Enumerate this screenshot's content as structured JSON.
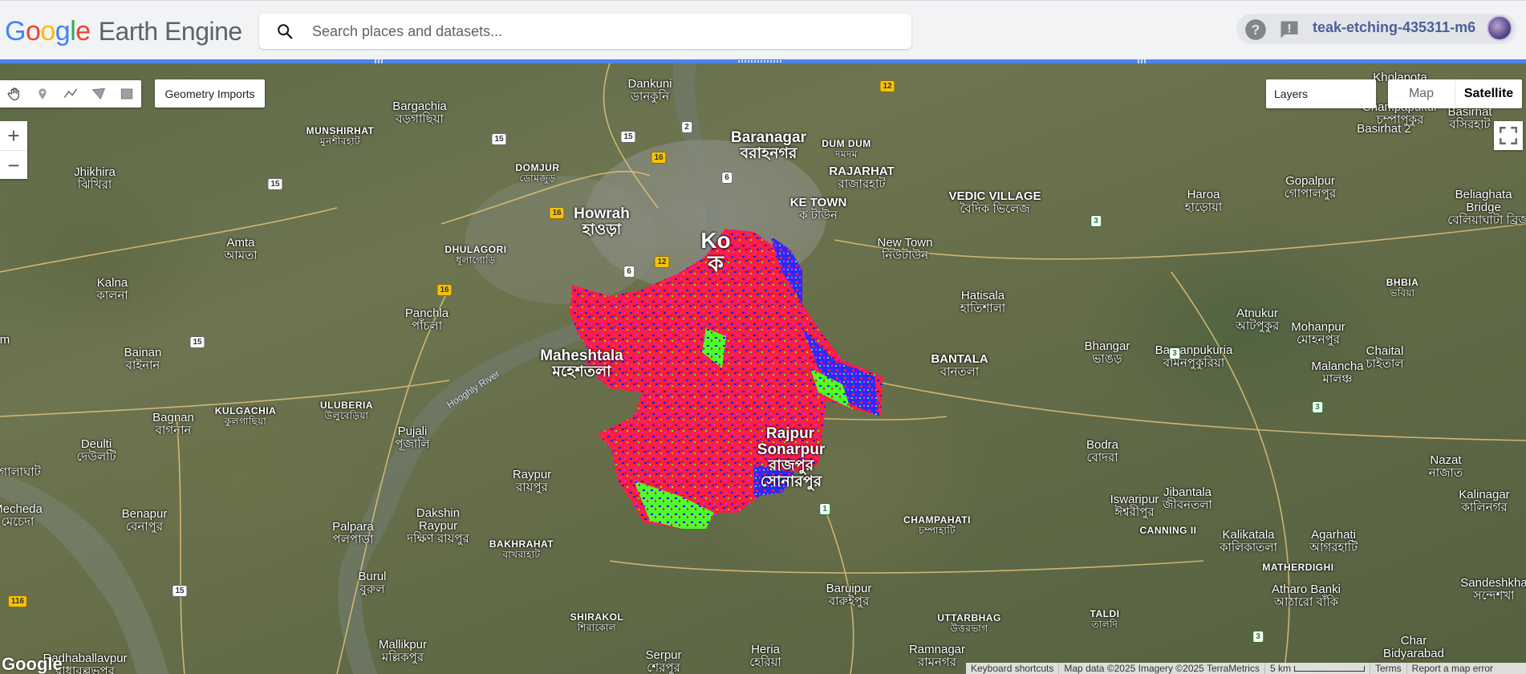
{
  "header": {
    "logo": {
      "g1": "G",
      "o1": "o",
      "o2": "o",
      "g2": "g",
      "l": "l",
      "e": "e",
      "product": "Earth Engine"
    },
    "search": {
      "placeholder": "Search places and datasets..."
    },
    "help_icon": "help-circle-icon",
    "feedback_icon": "feedback-icon",
    "project": "teak-etching-435311-m6"
  },
  "map_toolbar": {
    "tools": [
      "pan-hand-icon",
      "point-marker-icon",
      "line-icon",
      "polygon-icon",
      "rectangle-icon"
    ],
    "geometry_imports": "Geometry Imports"
  },
  "zoom": {
    "in": "+",
    "out": "−"
  },
  "layers": {
    "label": "Layers"
  },
  "map_type": {
    "map": "Map",
    "satellite": "Satellite",
    "selected": "Satellite"
  },
  "footer": {
    "watermark": "Google",
    "keyboard": "Keyboard shortcuts",
    "map_data": "Map data ©2025 Imagery ©2025 TerraMetrics",
    "scale": "5 km",
    "terms": "Terms",
    "report": "Report a map error"
  },
  "overlay_colors": {
    "red": "#ff1e3c",
    "blue": "#1a1aff",
    "green": "#4dff2a",
    "magenta": "#e01cff"
  },
  "places": {
    "baranagar": {
      "en": "Baranagar",
      "bn": "বরাহনগর"
    },
    "howrah": {
      "en": "Howrah",
      "bn": "হাওড়া"
    },
    "kolkata": {
      "en": "Ko",
      "bn": "ক"
    },
    "maheshtala": {
      "en": "Maheshtala",
      "bn": "মহেশতলা"
    },
    "rajpur": {
      "en": "Rajpur",
      "bn": ""
    },
    "sonarpur": {
      "en": "Sonarpur",
      "bn": "রাজপুর সোনারপুর"
    },
    "dankuni": {
      "en": "Dankuni",
      "bn": "ডানকুনি"
    },
    "bargachia": {
      "en": "Bargachia",
      "bn": "বড়গাছিয়া"
    },
    "munshirhat": {
      "en": "MUNSHIRHAT",
      "bn": "মুনশীরহাট"
    },
    "domjur": {
      "en": "DOMJUR",
      "bn": "ডোমজুড়"
    },
    "dumdum": {
      "en": "DUM DUM",
      "bn": "দমদম"
    },
    "rajarhat": {
      "en": "RAJARHAT",
      "bn": "রাজারহাট"
    },
    "laketown": {
      "en": "KE TOWN",
      "bn": "ক টাউন"
    },
    "vedic": {
      "en": "VEDIC VILLAGE",
      "bn": "বৈদিক ভিলেজ"
    },
    "haroa": {
      "en": "Haroa",
      "bn": "হাড়োয়া"
    },
    "gopalpur": {
      "en": "Gopalpur",
      "bn": "গোপালপুর"
    },
    "basirhat2": {
      "en": "Basirhat 2",
      "bn": ""
    },
    "basirhat": {
      "en": "Basirhat",
      "bn": "বসিরহাট"
    },
    "khola": {
      "en": "Kholapota",
      "bn": ""
    },
    "champapukur": {
      "en": "Champapukur",
      "bn": "চম্পাপুকুর"
    },
    "beliaghata": {
      "en": "Beliaghata Bridge",
      "bn": "বেলিয়াঘাটা ব্রিজ"
    },
    "jhikhira": {
      "en": "Jhikhira",
      "bn": "ঝিখিরা"
    },
    "amta": {
      "en": "Amta",
      "bn": "আমতা"
    },
    "dhulagori": {
      "en": "DHULAGORI",
      "bn": "ধূলাগোড়ি"
    },
    "newtown": {
      "en": "New Town",
      "bn": "নিউটাউন"
    },
    "hatisala": {
      "en": "Hatisala",
      "bn": "হাতিশালা"
    },
    "kalna": {
      "en": "Kalna",
      "bn": "কালনা"
    },
    "panchla": {
      "en": "Panchla",
      "bn": "পাঁচলা"
    },
    "atnukur": {
      "en": "Atnukur",
      "bn": "আটপুকুর"
    },
    "mohanpur": {
      "en": "Mohanpur",
      "bn": "মোহনপুর"
    },
    "bhbia": {
      "en": "BHBIA",
      "bn": "ভবিয়া"
    },
    "bainan": {
      "en": "Bainan",
      "bn": "বাইনান"
    },
    "bantala": {
      "en": "BANTALA",
      "bn": "বানতলা"
    },
    "bhangar": {
      "en": "Bhangar",
      "bn": "ভাঙড়"
    },
    "bamanpukuria": {
      "en": "Bamanpukuria",
      "bn": "বামনপুকুরিয়া"
    },
    "malancha": {
      "en": "Malancha",
      "bn": "মালঞ্চ"
    },
    "chaital": {
      "en": "Chaital",
      "bn": "চাইতাল"
    },
    "bagnan": {
      "en": "Bagnan",
      "bn": "বাগনান"
    },
    "kulgachia": {
      "en": "KULGACHIA",
      "bn": "কুলগাছিয়া"
    },
    "uluberia": {
      "en": "ULUBERIA",
      "bn": "উলুবেড়িয়া"
    },
    "pujali": {
      "en": "Pujali",
      "bn": "পূজালি"
    },
    "deulti": {
      "en": "Deulti",
      "bn": "দেউলটি"
    },
    "golaghat": {
      "en": "...",
      "bn": "গোলাঘাট"
    },
    "raypur": {
      "en": "Raypur",
      "bn": "রায়পুর"
    },
    "bodra": {
      "en": "Bodra",
      "bn": "বোদরা"
    },
    "iswaripur": {
      "en": "Iswaripur",
      "bn": "ঈশ্বরীপুর"
    },
    "jibantala": {
      "en": "Jibantala",
      "bn": "জীবনতলা"
    },
    "nazat": {
      "en": "Nazat",
      "bn": "নাজাত"
    },
    "kalinagar": {
      "en": "Kalinagar",
      "bn": "কালিনগর"
    },
    "mecheda": {
      "en": "Mecheda",
      "bn": "মেচেদা"
    },
    "benapur": {
      "en": "Benapur",
      "bn": "বেনাপুর"
    },
    "palpara": {
      "en": "Palpara",
      "bn": "পলপাড়া"
    },
    "dakshin": {
      "en": "Dakshin Raypur",
      "bn": "দক্ষিণ রায়পুর"
    },
    "bakhrahat": {
      "en": "BAKHRAHAT",
      "bn": "বাখরাহাট"
    },
    "champahati": {
      "en": "CHAMPAHATI",
      "bn": "চম্পাহাটি"
    },
    "canning": {
      "en": "CANNING II",
      "bn": ""
    },
    "kalikatala": {
      "en": "Kalikatala",
      "bn": "কালিকাতলা"
    },
    "agarhati": {
      "en": "Agarhati",
      "bn": "আগরহাটি"
    },
    "burul": {
      "en": "Burul",
      "bn": "বুরুল"
    },
    "shirakol": {
      "en": "SHIRAKOL",
      "bn": "শিরাকোল"
    },
    "baruipur": {
      "en": "Baruipur",
      "bn": "বারুইপুর"
    },
    "matherdighi": {
      "en": "MATHERDIGHI",
      "bn": ""
    },
    "atharo": {
      "en": "Atharo Banki",
      "bn": "আঠারো বাঁকি"
    },
    "sandeshkhali": {
      "en": "Sandeshkha",
      "bn": "সন্দেশখা"
    },
    "uttarbhag": {
      "en": "UTTARBHAG",
      "bn": "উত্তরভাগ"
    },
    "taldi": {
      "en": "TALDI",
      "bn": "তালদি"
    },
    "mallikpur": {
      "en": "Mallikpur",
      "bn": "মল্লিকপুর"
    },
    "serpur": {
      "en": "Serpur",
      "bn": "শেরপুর"
    },
    "heria": {
      "en": "Heria",
      "bn": "হেরিয়া"
    },
    "ramnagar": {
      "en": "Ramnagar",
      "bn": "রামনগর"
    },
    "radhaballav": {
      "en": "Radhaballavpur",
      "bn": "রাধাবল্লভপুর"
    },
    "char": {
      "en": "Char Bidyarabad",
      "bn": ""
    },
    "edge_m": {
      "en": "m",
      "bn": ""
    },
    "river": "Hooghly River"
  },
  "shields": {
    "r2": "2",
    "r15a": "15",
    "r15b": "15",
    "r15c": "15",
    "r15d": "15",
    "r15e": "15",
    "r16a": "16",
    "r16b": "16",
    "r16c": "16",
    "r12a": "12",
    "r12b": "12",
    "r6a": "6",
    "r6b": "6",
    "r3a": "3",
    "r3b": "3",
    "r3c": "3",
    "r3d": "3",
    "r1": "1",
    "r116": "116"
  }
}
